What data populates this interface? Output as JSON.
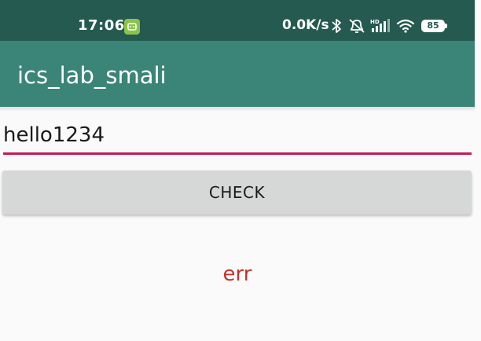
{
  "status_bar": {
    "time": "17:06",
    "network_speed": "0.0K/s",
    "battery_level": "85",
    "notification_icon": "app-notification-icon",
    "icons": [
      "bluetooth-icon",
      "alarm-off-icon",
      "hd-signal-icon",
      "wifi-icon",
      "battery-icon"
    ]
  },
  "app_bar": {
    "title": "ics_lab_smali"
  },
  "input": {
    "value": "hello1234"
  },
  "check_button": {
    "label": "CHECK"
  },
  "result": {
    "text": "err"
  },
  "colors": {
    "status_bar": "#245a4f",
    "app_bar": "#3b8478",
    "accent": "#c4195a",
    "error_text": "#c4322a",
    "button": "#d6d7d7"
  }
}
